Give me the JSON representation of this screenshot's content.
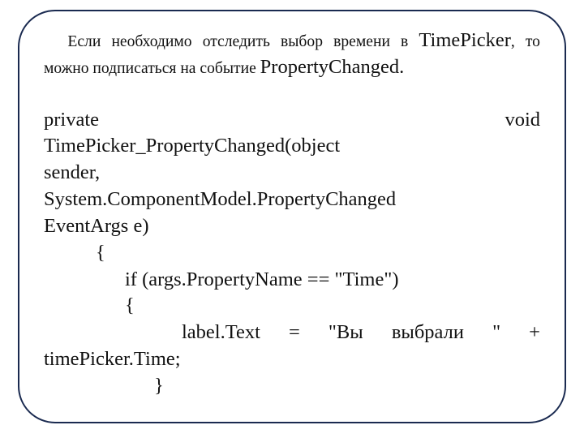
{
  "intro": {
    "prefix": "Если необходимо отследить выбор времени в ",
    "timepicker": "TimePicker",
    "mid": ", то можно подписаться на событие ",
    "propchanged": "PropertyChanged."
  },
  "code": {
    "l1_private": "private",
    "l1_void": "void",
    "l2": "TimePicker_PropertyChanged(object",
    "l3": "sender,",
    "l4": "System.ComponentModel.PropertyChanged",
    "l5": "EventArgs e)",
    "l6": "{",
    "l7": "if (args.PropertyName == \"Time\")",
    "l8": "{",
    "l9_lead": "",
    "l9_rest": "label.Text = \"Вы выбрали \" +",
    "l10": "timePicker.Time;",
    "l11": "}"
  }
}
